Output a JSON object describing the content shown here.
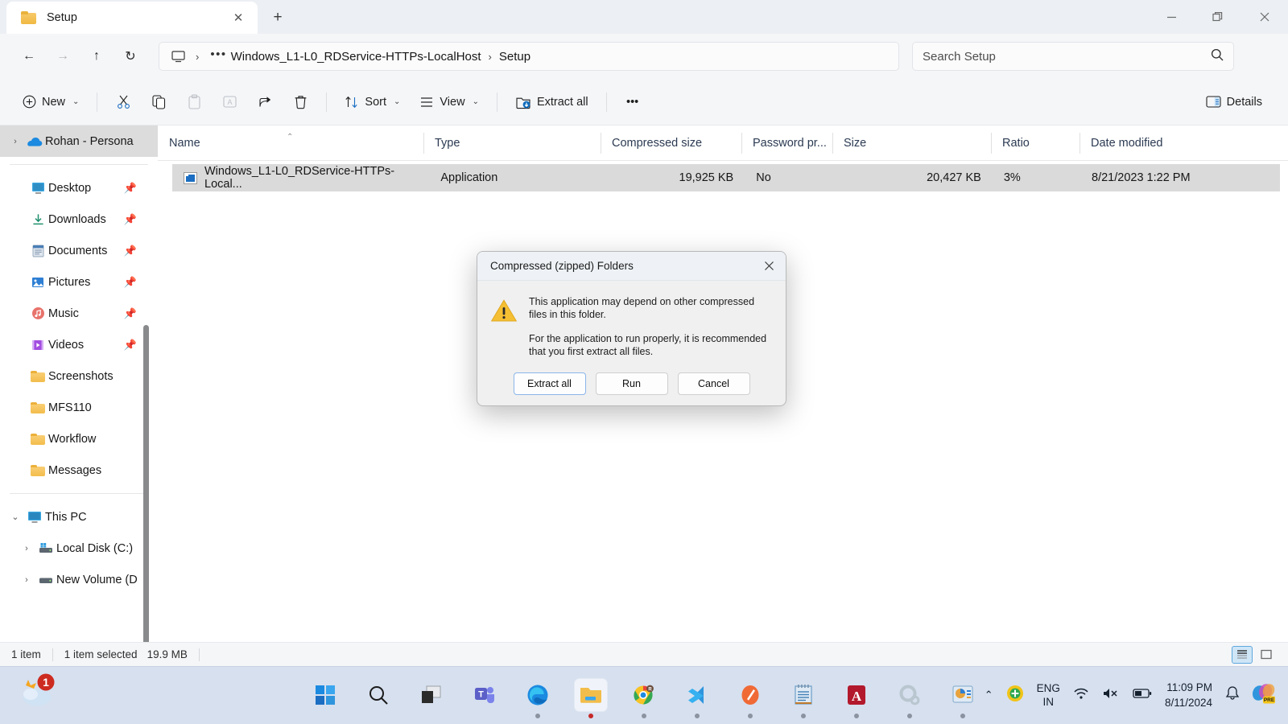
{
  "window": {
    "tab_label": "Setup",
    "tab_close_glyph": "✕",
    "newtab_glyph": "+",
    "minimize_title": "Minimize",
    "maximize_title": "Restore",
    "close_title": "Close"
  },
  "address": {
    "back_glyph": "←",
    "forward_glyph": "→",
    "up_glyph": "↑",
    "refresh_glyph": "↻",
    "overflow_glyph": "•••",
    "crumb_sep": "›",
    "crumb1": "Windows_L1-L0_RDService-HTTPs-LocalHost",
    "crumb2": "Setup",
    "search_placeholder": "Search Setup",
    "search_value": ""
  },
  "toolbar": {
    "new_label": "New",
    "new_glyph": "⊕",
    "chevron": "⌄",
    "cut_label": "Cut",
    "copy_label": "Copy",
    "paste_label": "Paste",
    "rename_label": "Rename",
    "share_label": "Share",
    "delete_label": "Delete",
    "sort_label": "Sort",
    "view_label": "View",
    "extract_all_label": "Extract all",
    "more_label": "See more",
    "more_glyph": "•••",
    "details_label": "Details"
  },
  "sidebar": {
    "onedrive": {
      "label": "Rohan - Persona",
      "chevron": "›"
    },
    "quick_access": [
      {
        "label": "Desktop",
        "icon": "desktop-icon",
        "pinned": true
      },
      {
        "label": "Downloads",
        "icon": "downloads-icon",
        "pinned": true
      },
      {
        "label": "Documents",
        "icon": "documents-icon",
        "pinned": true
      },
      {
        "label": "Pictures",
        "icon": "pictures-icon",
        "pinned": true
      },
      {
        "label": "Music",
        "icon": "music-icon",
        "pinned": true
      },
      {
        "label": "Videos",
        "icon": "videos-icon",
        "pinned": true
      },
      {
        "label": "Screenshots",
        "icon": "folder-icon",
        "pinned": false
      },
      {
        "label": "MFS110",
        "icon": "folder-icon",
        "pinned": false
      },
      {
        "label": "Workflow",
        "icon": "folder-icon",
        "pinned": false
      },
      {
        "label": "Messages",
        "icon": "folder-icon",
        "pinned": false
      }
    ],
    "this_pc": {
      "label": "This PC",
      "chevron": "⌄"
    },
    "drives": [
      {
        "label": "Local Disk (C:)",
        "chevron": "›"
      },
      {
        "label": "New Volume (D",
        "chevron": "›"
      }
    ],
    "pin_glyph": "📌"
  },
  "filelist": {
    "columns": [
      {
        "key": "name",
        "label": "Name",
        "sorted": true,
        "sort_glyph": "⌃"
      },
      {
        "key": "type",
        "label": "Type"
      },
      {
        "key": "compressed",
        "label": "Compressed size"
      },
      {
        "key": "password",
        "label": "Password pr..."
      },
      {
        "key": "size",
        "label": "Size"
      },
      {
        "key": "ratio",
        "label": "Ratio"
      },
      {
        "key": "modified",
        "label": "Date modified"
      }
    ],
    "rows": [
      {
        "name": "Windows_L1-L0_RDService-HTTPs-Local...",
        "type": "Application",
        "compressed": "19,925 KB",
        "password": "No",
        "size": "20,427 KB",
        "ratio": "3%",
        "modified": "8/21/2023 1:22 PM",
        "selected": true
      }
    ]
  },
  "statusbar": {
    "item_count": "1 item",
    "selection": "1 item selected",
    "selection_size": "19.9 MB",
    "details_view_active": true
  },
  "dialog": {
    "title": "Compressed (zipped) Folders",
    "close_glyph": "✕",
    "warning_icon": "warning-triangle-icon",
    "paragraph1": "This application may depend on other compressed files in this folder.",
    "paragraph2": "For the application to run properly, it is recommended that you first extract all files.",
    "buttons": [
      {
        "label": "Extract all",
        "default": true
      },
      {
        "label": "Run",
        "default": false
      },
      {
        "label": "Cancel",
        "default": false
      }
    ]
  },
  "taskbar": {
    "weather_badge": "1",
    "apps": [
      {
        "name": "start-button",
        "running": false
      },
      {
        "name": "search-button",
        "running": false
      },
      {
        "name": "task-view-button",
        "running": false
      },
      {
        "name": "teams-icon",
        "running": false
      },
      {
        "name": "edge-icon",
        "running": true
      },
      {
        "name": "file-explorer-icon",
        "running": true
      },
      {
        "name": "chrome-icon",
        "running": true
      },
      {
        "name": "vscode-icon",
        "running": true
      },
      {
        "name": "paint-icon",
        "running": true
      },
      {
        "name": "notepad-icon",
        "running": true
      },
      {
        "name": "acrobat-icon",
        "running": true
      },
      {
        "name": "settings-icon",
        "running": true
      },
      {
        "name": "powerpoint-icon",
        "running": true
      }
    ],
    "tray": {
      "overflow_glyph": "⌃",
      "language_line1": "ENG",
      "language_line2": "IN",
      "time": "11:09 PM",
      "date": "8/11/2024",
      "copilot_label": "PRE"
    }
  },
  "colors": {
    "accent": "#0f6cbd",
    "selection": "#dadada",
    "chrome": "#f5f6f8",
    "taskbar": "#d6e0ef",
    "warning": "#f5bf33"
  }
}
